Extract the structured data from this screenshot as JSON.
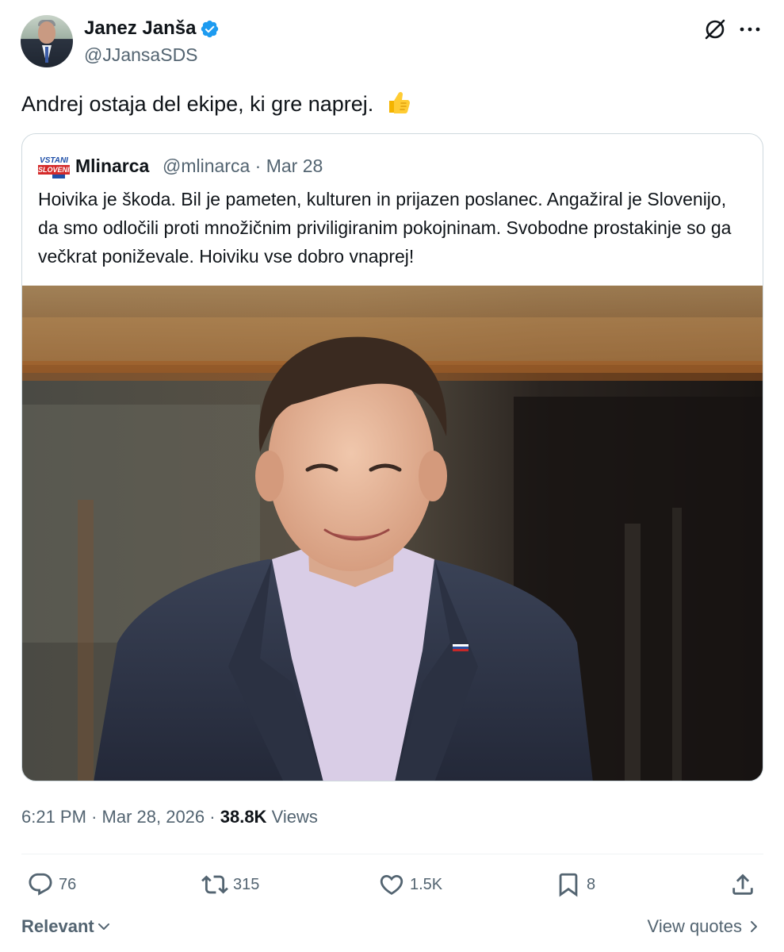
{
  "tweet": {
    "author_name": "Janez Janša",
    "author_handle": "@JJansaSDS",
    "verified": true,
    "text": "Andrej ostaja del ekipe, ki gre naprej.",
    "emoji": "thumbs-up",
    "header_icons": [
      "grok-icon",
      "more-options-icon"
    ]
  },
  "quoted_tweet": {
    "author_name": "Mlinarca",
    "author_handle": "@mlinarca",
    "date": "Mar 28",
    "avatar_text_top": "VSTANI",
    "avatar_text_bottom": "SLOVENIJA",
    "text": "Hoivika je škoda. Bil je pameten, kulturen in prijazen poslanec. Angažiral je Slovenijo, da smo odločili proti množičnim priviligiranim pokojninam. Svobodne prostakinje so ga večkrat poniževale. Hoiviku vse dobro vnaprej!",
    "photo": "man-in-suit-smiling"
  },
  "meta": {
    "time": "6:21 PM",
    "date": "Mar 28, 2026",
    "views_count": "38.8K",
    "views_label": "Views",
    "separator": "·"
  },
  "actions": {
    "replies": "76",
    "retweets": "315",
    "likes": "1.5K",
    "bookmarks": "8"
  },
  "footer": {
    "sort_label": "Relevant",
    "view_quotes_label": "View quotes"
  },
  "colors": {
    "text_primary": "#0f1419",
    "text_secondary": "#536471",
    "verified_blue": "#1d9bf0",
    "border": "#cfd9de"
  }
}
